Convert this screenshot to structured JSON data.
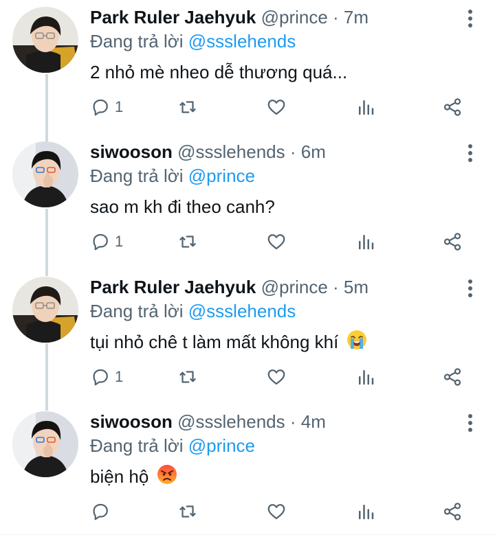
{
  "tweets": [
    {
      "name": "Park Ruler Jaehyuk",
      "handle": "@prince",
      "time": "7m",
      "replying_prefix": "Đang trả lời ",
      "replying_to": "@ssslehends",
      "text": "2 nhỏ mè nheo dễ thương quá...",
      "reply_count": "1",
      "avatar": "park-avatar",
      "emoji": ""
    },
    {
      "name": "siwooson",
      "handle": "@ssslehends",
      "time": "6m",
      "replying_prefix": "Đang trả lời ",
      "replying_to": "@prince",
      "text": "sao m kh đi theo canh?",
      "reply_count": "1",
      "avatar": "siwoo-avatar",
      "emoji": ""
    },
    {
      "name": "Park Ruler Jaehyuk",
      "handle": "@prince",
      "time": "5m",
      "replying_prefix": "Đang trả lời ",
      "replying_to": "@ssslehends",
      "text": "tụi nhỏ chê t làm mất không khí",
      "reply_count": "1",
      "avatar": "park-avatar",
      "emoji": "loudly-crying-face"
    },
    {
      "name": "siwooson",
      "handle": "@ssslehends",
      "time": "4m",
      "replying_prefix": "Đang trả lời ",
      "replying_to": "@prince",
      "text": "biện hộ",
      "reply_count": "",
      "avatar": "siwoo-avatar",
      "emoji": "angry-face"
    }
  ],
  "separator": " · ",
  "colors": {
    "text": "#0f1419",
    "secondary": "#536471",
    "link": "#1d9bf0",
    "thread_line": "#cfd9de"
  },
  "icons": [
    "reply-icon",
    "retweet-icon",
    "like-icon",
    "views-icon",
    "share-icon",
    "more-options-icon"
  ]
}
